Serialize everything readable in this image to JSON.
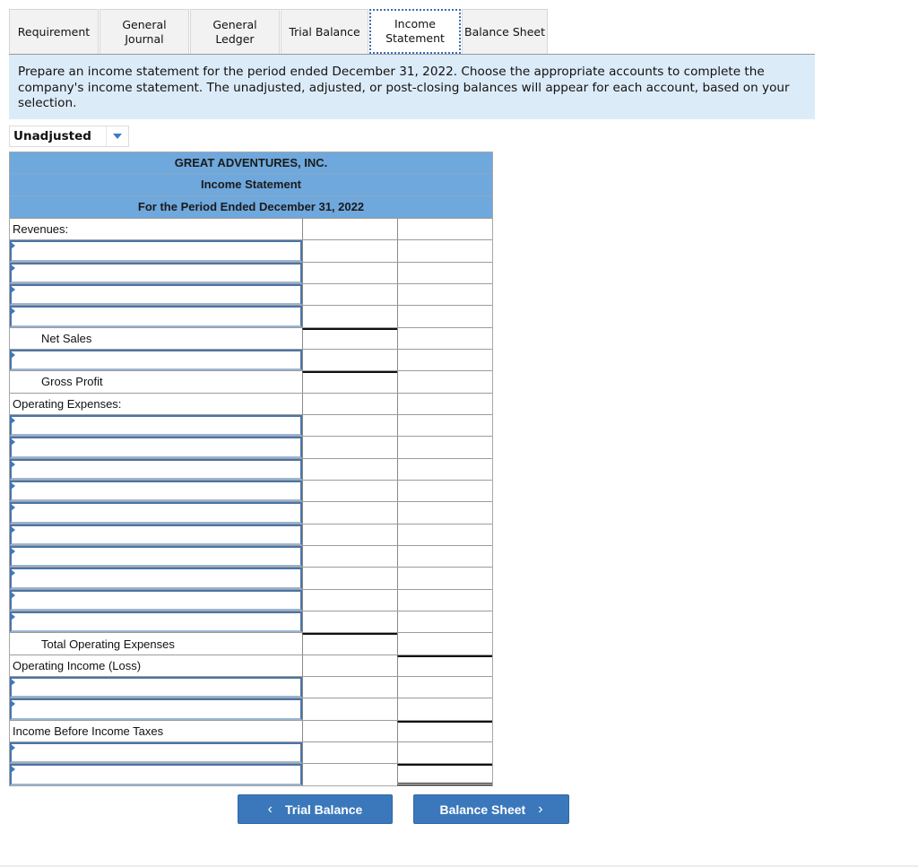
{
  "tabs": [
    {
      "label": "Requirement",
      "active": false
    },
    {
      "label": "General Journal",
      "active": false
    },
    {
      "label": "General Ledger",
      "active": false
    },
    {
      "label": "Trial Balance",
      "active": false
    },
    {
      "label": "Income Statement",
      "active": true
    },
    {
      "label": "Balance Sheet",
      "active": false
    }
  ],
  "instructions": "Prepare an income statement for the period ended December 31, 2022. Choose the appropriate accounts to complete the company's income statement. The unadjusted, adjusted, or post-closing balances will appear for each account, based on your selection.",
  "balance_selector": {
    "selected": "Unadjusted"
  },
  "statement": {
    "company": "GREAT ADVENTURES, INC.",
    "title": "Income Statement",
    "period": "For the Period Ended December 31, 2022",
    "labels": {
      "revenues": "Revenues:",
      "net_sales": "Net Sales",
      "gross_profit": "Gross Profit",
      "operating_expenses": "Operating Expenses:",
      "total_operating_expenses": "Total Operating Expenses",
      "operating_income": "Operating Income (Loss)",
      "income_before_taxes": "Income Before Income Taxes"
    },
    "account_inputs": {
      "revenue_accounts": [
        "",
        "",
        "",
        ""
      ],
      "cost_account": [
        ""
      ],
      "operating_expense_accounts": [
        "",
        "",
        "",
        "",
        "",
        "",
        "",
        "",
        "",
        ""
      ],
      "other_accounts": [
        "",
        ""
      ],
      "tax_accounts": [
        "",
        ""
      ]
    }
  },
  "navigation": {
    "prev_label": "Trial Balance",
    "next_label": "Balance Sheet",
    "prev_icon": "chevron-left-icon",
    "next_icon": "chevron-right-icon"
  }
}
